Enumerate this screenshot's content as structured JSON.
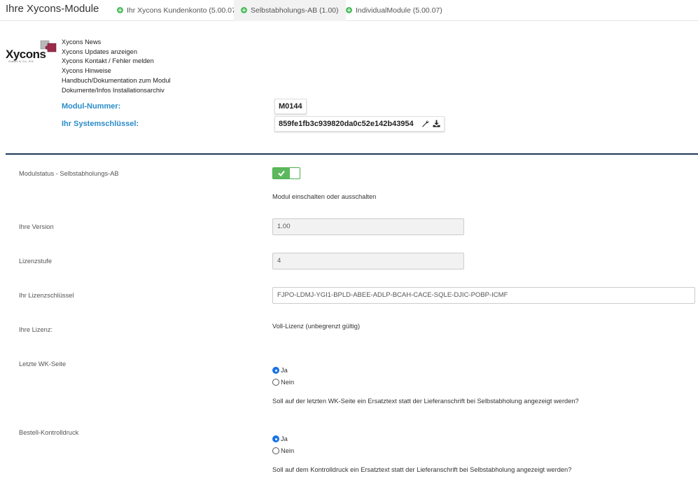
{
  "header": {
    "title": "Ihre Xycons-Module",
    "tabs": [
      {
        "label": "Ihr Xycons Kundenkonto (5.00.07)",
        "active": false
      },
      {
        "label": "Selbstabholungs-AB (1.00)",
        "active": true
      },
      {
        "label": "IndividualModule (5.00.07)",
        "active": false
      }
    ],
    "status_color": "#4dbd5c"
  },
  "info": {
    "logo_text": "Xycons",
    "logo_sub": "GmbH & Co. KG",
    "links": [
      "Xycons News",
      "Xycons Updates anzeigen",
      "Xycons Kontakt / Fehler melden",
      "Xycons Hinweise",
      "Handbuch/Dokumentation zum Modul",
      "Dokumente/Infos Installationsarchiv"
    ],
    "modul_nummer_label": "Modul-Nummer:",
    "modul_nummer": "M0144",
    "systemschluessel_label": "Ihr Systemschlüssel:",
    "systemschluessel": "859fe1fb3c939820da0c52e142b43954",
    "accent_color": "#2a8cc8"
  },
  "form": {
    "modulstatus": {
      "label": "Modulstatus - Selbstabholungs-AB",
      "enabled": true,
      "help": "Modul einschalten oder ausschalten"
    },
    "version": {
      "label": "Ihre Version",
      "value": "1.00"
    },
    "lizenzstufe": {
      "label": "Lizenzstufe",
      "value": "4"
    },
    "lizenzschluessel": {
      "label": "Ihr Lizenzschlüssel",
      "value": "FJPO-LDMJ-YGI1-BPLD-ABEE-ADLP-BCAH-CACE-SQLE-DJIC-POBP-ICMF"
    },
    "lizenz": {
      "label": "Ihre Lizenz:",
      "value": "Voll-Lizenz (unbegrenzt gültig)"
    },
    "letzte_wk": {
      "label": "Letzte WK-Seite",
      "options": [
        "Ja",
        "Nein"
      ],
      "selected": "Ja",
      "help": "Soll auf der letzten WK-Seite ein Ersatztext statt der Lieferanschrift bei Selbstabholung angezeigt werden?"
    },
    "kontrolldruck": {
      "label": "Bestell-Kontrolldruck",
      "options": [
        "Ja",
        "Nein"
      ],
      "selected": "Ja",
      "help": "Soll auf dem Kontrolldruck ein Ersatztext statt der Lieferanschrift bei Selbstabholung angezeigt werden?"
    }
  }
}
